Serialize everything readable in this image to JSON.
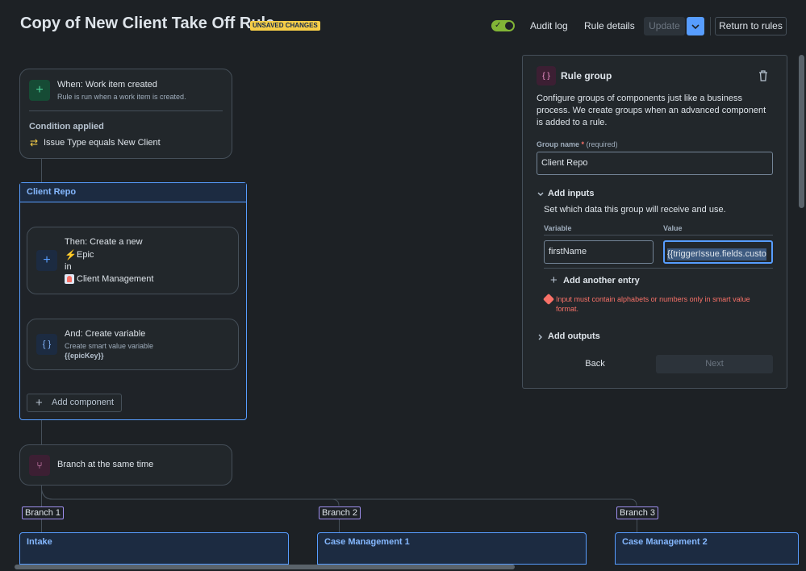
{
  "header": {
    "title": "Copy of New Client Take Off Rule",
    "badge": "UNSAVED CHANGES",
    "audit_log": "Audit log",
    "rule_details": "Rule details",
    "update": "Update",
    "return": "Return to rules"
  },
  "trigger": {
    "title": "When: Work item created",
    "subtitle": "Rule is run when a work item is created.",
    "condition_label": "Condition applied",
    "condition_text": "Issue Type equals New Client"
  },
  "group": {
    "name": "Client Repo",
    "create_title": "Then: Create a new",
    "create_type": "Epic",
    "create_in": "in",
    "create_project": "Client Management",
    "var_title": "And: Create variable",
    "var_sub": "Create smart value variable",
    "var_key": "{{epicKey}}",
    "add_component": "Add component"
  },
  "branch_node": {
    "label": "Branch at the same time"
  },
  "branches": [
    {
      "tag": "Branch 1",
      "name": "Intake"
    },
    {
      "tag": "Branch 2",
      "name": "Case Management 1"
    },
    {
      "tag": "Branch 3",
      "name": "Case Management 2"
    }
  ],
  "panel": {
    "title": "Rule group",
    "desc_1": "Configure groups of components just like a business",
    "desc_2": "process. We create groups when an advanced component",
    "desc_3": "is added to a rule.",
    "group_name_label": "Group name",
    "required_star": "*",
    "required_text": "(required)",
    "group_name_value": "Client Repo",
    "add_inputs": "Add inputs",
    "inputs_help": "Set which data this group will receive and use.",
    "col_variable": "Variable",
    "col_value": "Value",
    "variable_value": "firstName",
    "value_value": "{{triggerIssue.fields.custo",
    "add_entry": "Add another entry",
    "error_1": "Input must contain alphabets or numbers only in smart value",
    "error_2": "format.",
    "add_outputs": "Add outputs",
    "back": "Back",
    "next": "Next"
  },
  "colors": {
    "background": "#1d2125",
    "accent": "#579dff",
    "toggle_on": "#82b536",
    "badge": "#f5cd47",
    "error": "#f87168"
  }
}
